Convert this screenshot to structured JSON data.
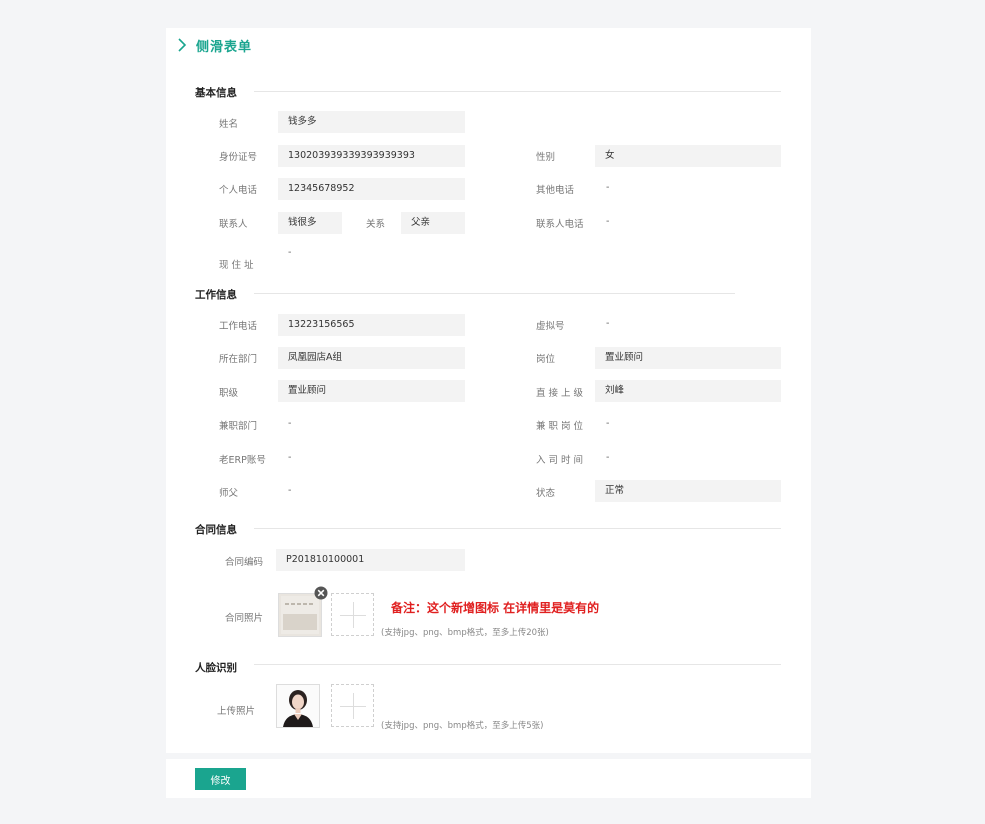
{
  "page": {
    "title": "侧滑表单"
  },
  "sections": {
    "basic": "基本信息",
    "work": "工作信息",
    "contract": "合同信息",
    "face": "人脸识别"
  },
  "basic": {
    "name_label": "姓名",
    "name_value": "钱多多",
    "id_label": "身份证号",
    "id_value": "130203939339393939393",
    "gender_label": "性别",
    "gender_value": "女",
    "phone_label": "个人电话",
    "phone_value": "12345678952",
    "other_phone_label": "其他电话",
    "other_phone_value": "-",
    "contact_label": "联系人",
    "contact_value": "钱很多",
    "relation_label": "关系",
    "relation_value": "父亲",
    "contact_phone_label": "联系人电话",
    "contact_phone_value": "-",
    "address_label": "现 住 址",
    "address_value": "-"
  },
  "work": {
    "work_phone_label": "工作电话",
    "work_phone_value": "13223156565",
    "virtual_label": "虚拟号",
    "virtual_value": "-",
    "dept_label": "所在部门",
    "dept_value": "凤凰园店A组",
    "post_label": "岗位",
    "post_value": "置业顾问",
    "rank_label": "职级",
    "rank_value": "置业顾问",
    "superior_label": "直 接 上 级",
    "superior_value": "刘峰",
    "part_dept_label": "兼职部门",
    "part_dept_value": "-",
    "part_post_label": "兼 职 岗 位",
    "part_post_value": "-",
    "erp_label": "老ERP账号",
    "erp_value": "-",
    "join_label": "入 司 时 间",
    "join_value": "-",
    "mentor_label": "师父",
    "mentor_value": "-",
    "status_label": "状态",
    "status_value": "正常"
  },
  "contract": {
    "code_label": "合同编码",
    "code_value": "P201810100001",
    "photo_label": "合同照片",
    "note": "备注：这个新增图标 在详情里是莫有的",
    "hint": "(支持jpg、png、bmp格式，至多上传20张)"
  },
  "face": {
    "upload_label": "上传照片",
    "hint": "(支持jpg、png、bmp格式，至多上传5张)"
  },
  "footer": {
    "edit_label": "修改"
  },
  "colors": {
    "accent": "#1aa58f",
    "note": "#e02020",
    "field_bg": "#f3f3f3"
  },
  "icons": [
    "chevron-right-icon",
    "close-circle-icon",
    "plus-icon"
  ]
}
